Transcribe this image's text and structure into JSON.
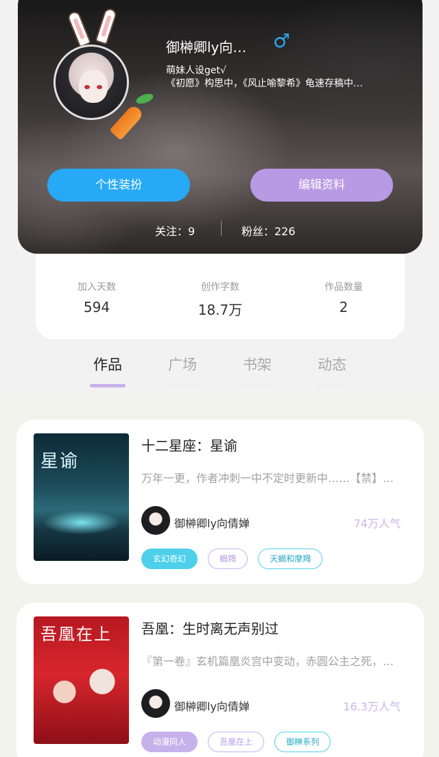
{
  "profile": {
    "username": "御榊卿ly向…",
    "gender_icon": "male-icon",
    "bio_line1": "萌妹人设get√",
    "bio_line2": "《初愿》构思中，《风止喻黎希》龟速存稿中…",
    "dress_button": "个性装扮",
    "edit_button": "编辑资料",
    "follow_text": "关注：9",
    "fans_text": "粉丝：226"
  },
  "stats": [
    {
      "label": "加入天数",
      "value": "594"
    },
    {
      "label": "创作字数",
      "value": "18.7万"
    },
    {
      "label": "作品数量",
      "value": "2"
    }
  ],
  "tabs": [
    {
      "label": "作品",
      "active": true
    },
    {
      "label": "广场",
      "active": false
    },
    {
      "label": "书架",
      "active": false
    },
    {
      "label": "动态",
      "active": false
    }
  ],
  "books": [
    {
      "title": "十二星座：星谕",
      "description": "万年一更，作者冲刺一中不定时更新中……【禁】…",
      "author": "御榊卿ly向倩婵",
      "popularity": "74万人气",
      "cover_text": "星谕",
      "tags": [
        "玄幻奇幻",
        "蝎羯",
        "天蝎和摩羯"
      ]
    },
    {
      "title": "吾凰：生时离无声别过",
      "description": "『第一卷』玄机篇凰炎宫中变动，赤圆公主之死，…",
      "author": "御榊卿ly向倩婵",
      "popularity": "16.3万人气",
      "cover_text": "吾凰在上",
      "tags": [
        "动漫同人",
        "吾凰在上",
        "御榊系列"
      ]
    }
  ],
  "colors": {
    "accent_blue": "#27a9f5",
    "accent_purple": "#b899e4",
    "tab_indicator": "#c7b1ea"
  }
}
